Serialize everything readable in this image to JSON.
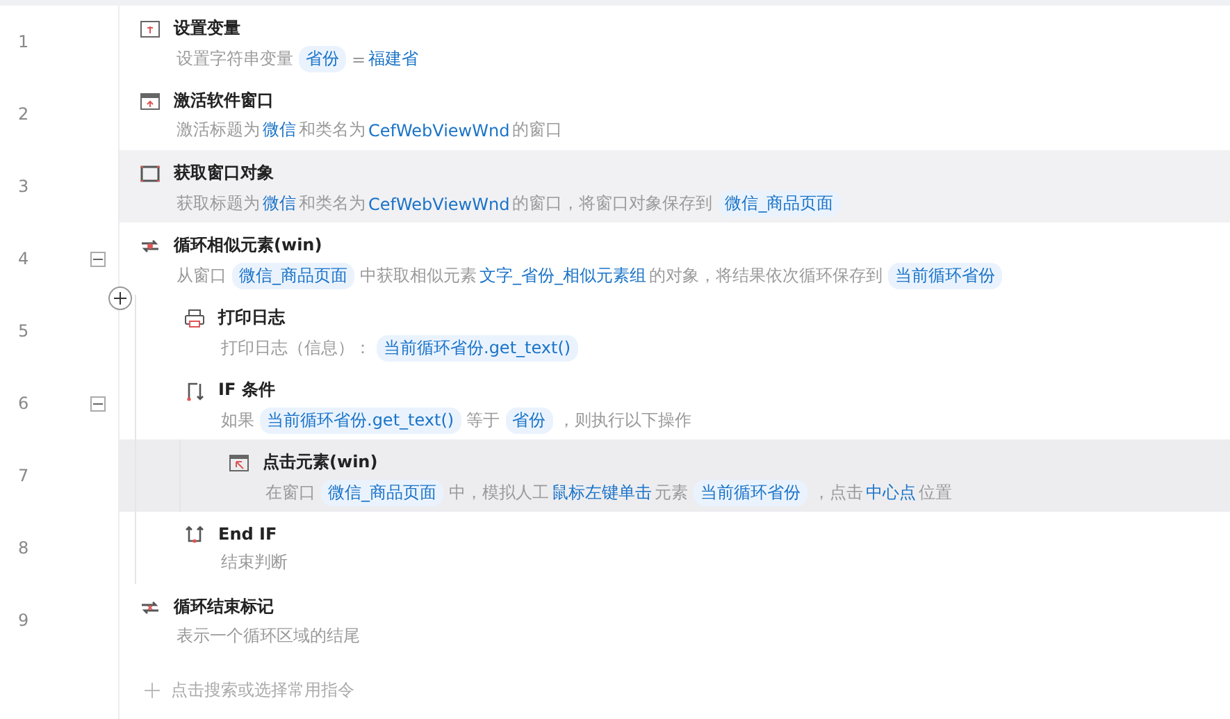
{
  "steps": [
    {
      "number": "1",
      "kind": "variable",
      "title": "设置变量",
      "selected": false,
      "hovered": false,
      "description": [
        {
          "kind": "plain",
          "text": "设置字符串变量"
        },
        {
          "kind": "chip",
          "text": "省份"
        },
        {
          "kind": "plain",
          "text": "="
        },
        {
          "kind": "link",
          "text": "福建省"
        }
      ]
    },
    {
      "number": "2",
      "kind": "window",
      "title": "激活软件窗口",
      "selected": false,
      "hovered": false,
      "description": [
        {
          "kind": "plain",
          "text": "激活标题为"
        },
        {
          "kind": "link",
          "text": "微信"
        },
        {
          "kind": "plain",
          "text": "和类名为"
        },
        {
          "kind": "link",
          "text": "CefWebViewWnd"
        },
        {
          "kind": "plain",
          "text": "的窗口"
        }
      ]
    },
    {
      "number": "3",
      "kind": "frame",
      "title": "获取窗口对象",
      "selected": false,
      "hovered": true,
      "description": [
        {
          "kind": "plain",
          "text": "获取标题为"
        },
        {
          "kind": "link",
          "text": "微信"
        },
        {
          "kind": "plain",
          "text": "和类名为"
        },
        {
          "kind": "link",
          "text": "CefWebViewWnd"
        },
        {
          "kind": "plain",
          "text": "的窗口，将窗口对象保存到"
        },
        {
          "kind": "chip",
          "text": "微信_商品页面"
        }
      ]
    },
    {
      "number": "4",
      "kind": "loop",
      "title": "循环相似元素(win)",
      "selected": false,
      "hovered": false,
      "expanded": true,
      "description": [
        {
          "kind": "plain",
          "text": "从窗口"
        },
        {
          "kind": "chip",
          "text": "微信_商品页面"
        },
        {
          "kind": "plain",
          "text": "中获取相似元素"
        },
        {
          "kind": "link",
          "text": "文字_省份_相似元素组"
        },
        {
          "kind": "plain",
          "text": "的对象，将结果依次循环保存到"
        },
        {
          "kind": "chip",
          "text": "当前循环省份"
        }
      ],
      "children": [
        {
          "number": "5",
          "kind": "printer",
          "title": "打印日志",
          "selected": false,
          "hovered": false,
          "description": [
            {
              "kind": "plain",
              "text": "打印日志（信息）："
            },
            {
              "kind": "chip",
              "text": "当前循环省份.get_text()"
            }
          ]
        },
        {
          "number": "6",
          "kind": "branch",
          "title": "IF 条件",
          "selected": false,
          "hovered": false,
          "expanded": true,
          "description": [
            {
              "kind": "plain",
              "text": "如果"
            },
            {
              "kind": "chip",
              "text": "当前循环省份.get_text()"
            },
            {
              "kind": "plain",
              "text": "等于"
            },
            {
              "kind": "chip",
              "text": "省份"
            },
            {
              "kind": "plain",
              "text": "，则执行以下操作"
            }
          ],
          "children": [
            {
              "number": "7",
              "kind": "click",
              "title": "点击元素(win)",
              "selected": true,
              "hovered": false,
              "description": [
                {
                  "kind": "plain",
                  "text": "在窗口"
                },
                {
                  "kind": "chip",
                  "text": "微信_商品页面"
                },
                {
                  "kind": "plain",
                  "text": "中，模拟人工"
                },
                {
                  "kind": "link",
                  "text": "鼠标左键单击"
                },
                {
                  "kind": "plain",
                  "text": "元素"
                },
                {
                  "kind": "chip",
                  "text": "当前循环省份"
                },
                {
                  "kind": "plain",
                  "text": "，点击"
                },
                {
                  "kind": "link",
                  "text": "中心点"
                },
                {
                  "kind": "plain",
                  "text": "位置"
                }
              ]
            }
          ]
        },
        {
          "number": "8",
          "kind": "endbranch",
          "title": "End IF",
          "selected": false,
          "hovered": false,
          "description": [
            {
              "kind": "plain",
              "text": "结束判断"
            }
          ]
        }
      ]
    },
    {
      "number": "9",
      "kind": "loopend",
      "title": "循环结束标记",
      "selected": false,
      "hovered": false,
      "description": [
        {
          "kind": "plain",
          "text": "表示一个循环区域的结尾"
        }
      ]
    }
  ],
  "add_step": {
    "label": "点击搜索或选择常用指令"
  }
}
